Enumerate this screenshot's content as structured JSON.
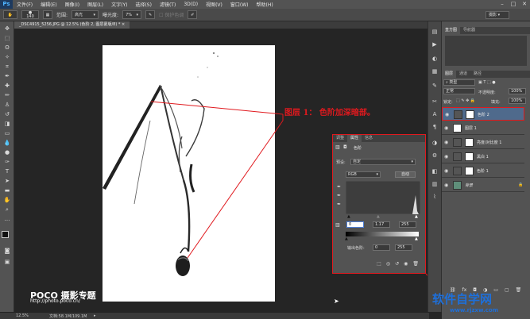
{
  "app": {
    "logo": "Ps"
  },
  "menu": [
    "文件(F)",
    "编辑(E)",
    "图像(I)",
    "图层(L)",
    "文字(Y)",
    "选择(S)",
    "滤镜(T)",
    "3D(D)",
    "视图(V)",
    "窗口(W)",
    "帮助(H)"
  ],
  "options": {
    "brush_size": "140",
    "mode_label": "范围:",
    "mode_value": "高光",
    "exposure_label": "曝光度:",
    "exposure_value": "7%",
    "protect_tones": "保护色调",
    "workspace": "摄影"
  },
  "document": {
    "tab": "_DSC4915_5256.JPG @ 12.5% (色阶 2, 图层蒙版/8) *"
  },
  "annotation": "图层 1： 色阶加深暗部。",
  "watermark": {
    "poco_title": "POCO 摄影专题",
    "poco_url": "http://photo.poco.cn/",
    "site_title": "软件自学网",
    "site_url": "www.rjzxw.com"
  },
  "status": {
    "zoom": "12.5%",
    "doc_info": "文档:58.1M/109.1M"
  },
  "properties": {
    "tabs": [
      "调整",
      "属性",
      "信息"
    ],
    "title": "色阶",
    "preset_label": "预设:",
    "preset_value": "自定",
    "channel_value": "RGB",
    "auto_label": "自动",
    "input_black": "0",
    "input_gamma": "1.17",
    "input_white": "255",
    "output_label": "输出色阶:",
    "output_black": "0",
    "output_white": "255"
  },
  "top_panel": {
    "tabs": [
      "直方图",
      "导航器"
    ]
  },
  "layers_panel": {
    "tabs": [
      "图层",
      "通道",
      "路径"
    ],
    "kind": "类型",
    "blend_mode": "正常",
    "opacity_label": "不透明度:",
    "opacity_value": "100%",
    "lock_label": "锁定:",
    "fill_label": "填充:",
    "fill_value": "100%",
    "layers": [
      {
        "name": "色阶 2",
        "selected": true
      },
      {
        "name": "图层 1",
        "selected": false
      },
      {
        "name": "亮度/对比度 1",
        "selected": false
      },
      {
        "name": "黑白 1",
        "selected": false
      },
      {
        "name": "色阶 1",
        "selected": false
      },
      {
        "name": "背景",
        "selected": false
      }
    ]
  },
  "colors": {
    "accent_red": "#e0191e",
    "selected_layer": "#4f6a8c",
    "site_blue": "#1e6fd9"
  }
}
